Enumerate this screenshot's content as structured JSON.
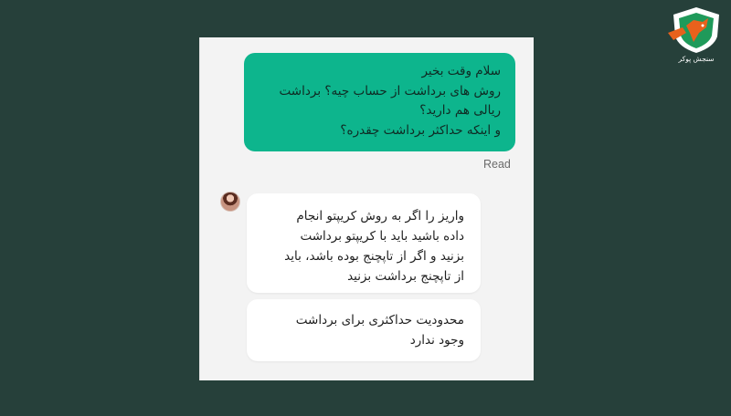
{
  "brand": {
    "name": "سنجش پوکر",
    "colors": {
      "shield_outer": "#ffffff",
      "shield_inner": "#1f9a5a",
      "accent": "#e8611c"
    }
  },
  "chat": {
    "outgoing": {
      "lines": [
        "سلام وقت بخیر",
        "روش های برداشت از حساب چیه؟ برداشت",
        "ریالی هم دارید؟",
        "و اینکه حداکثر برداشت چقدره؟"
      ],
      "status": "Read",
      "bubble_color": "#0db58d"
    },
    "incoming": [
      {
        "lines": [
          "واریز را اگر به روش کریپتو انجام",
          "داده باشید باید با کریپتو برداشت",
          "بزنید و اگر از تاپچنج بوده باشد، باید",
          "از تاپچنج برداشت بزنید"
        ]
      },
      {
        "lines": [
          "محدودیت حداکثری برای برداشت",
          "وجود ندارد"
        ]
      }
    ],
    "agent_avatar": "agent-avatar"
  }
}
